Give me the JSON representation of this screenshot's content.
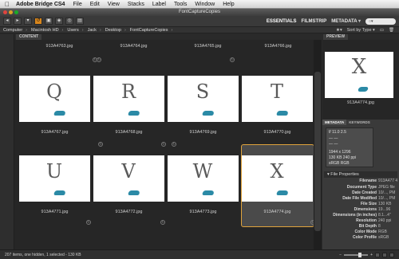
{
  "menubar": {
    "apple": "",
    "app": "Adobe Bridge CS4",
    "items": [
      "File",
      "Edit",
      "View",
      "Stacks",
      "Label",
      "Tools",
      "Window",
      "Help"
    ]
  },
  "window": {
    "title": "FontCaptureCopies"
  },
  "toolbar": {
    "workspaces": [
      "ESSENTIALS",
      "FILMSTRIP",
      "METADATA"
    ],
    "search_placeholder": "○▾"
  },
  "path": {
    "crumbs": [
      "Computer",
      "Macintosh HD",
      "Users",
      "Jack",
      "Desktop",
      "FontCaptureCopies"
    ],
    "sort_label": "Sort by Type ▾"
  },
  "content": {
    "tab": "CONTENT",
    "top_row": [
      "913A4763.jpg",
      "913A4764.jpg",
      "913A4765.jpg",
      "913A4766.jpg"
    ],
    "rows": [
      [
        {
          "letter": "Q",
          "name": "913A4767.jpg"
        },
        {
          "letter": "R",
          "name": "913A4768.jpg"
        },
        {
          "letter": "S",
          "name": "913A4769.jpg"
        },
        {
          "letter": "T",
          "name": "913A4770.jpg"
        }
      ],
      [
        {
          "letter": "U",
          "name": "913A4771.jpg"
        },
        {
          "letter": "V",
          "name": "913A4772.jpg"
        },
        {
          "letter": "W",
          "name": "913A4773.jpg"
        },
        {
          "letter": "X",
          "name": "913A4774.jpg"
        }
      ]
    ]
  },
  "preview": {
    "tab": "PREVIEW",
    "letter": "X",
    "caption": "913A4774.jpg"
  },
  "metadata": {
    "tabs": [
      "METADATA",
      "KEYWORDS"
    ],
    "camera": [
      "f/ 11.0   2.5",
      "—   —",
      "—   —",
      "1944 x 1296",
      "130 KB   240 ppi",
      "sRGB   RGB"
    ],
    "file_props_title": "File Properties",
    "file_props": [
      {
        "k": "Filename",
        "v": "913A477 4.jpg"
      },
      {
        "k": "Document Type",
        "v": "JPEG file"
      },
      {
        "k": "Date Created",
        "v": "10/..., PM"
      },
      {
        "k": "Date File Modified",
        "v": "10/..., PM"
      },
      {
        "k": "File Size",
        "v": "130 KB"
      },
      {
        "k": "Dimensions",
        "v": "19...96"
      },
      {
        "k": "Dimensions (in inches)",
        "v": "8.1...4\""
      },
      {
        "k": "Resolution",
        "v": "240 ppi"
      },
      {
        "k": "Bit Depth",
        "v": "8"
      },
      {
        "k": "Color Mode",
        "v": "RGB"
      },
      {
        "k": "Color Profile",
        "v": "sRGB"
      }
    ]
  },
  "status": {
    "text": "207 items, one hidden, 1 selected - 130 KB"
  }
}
